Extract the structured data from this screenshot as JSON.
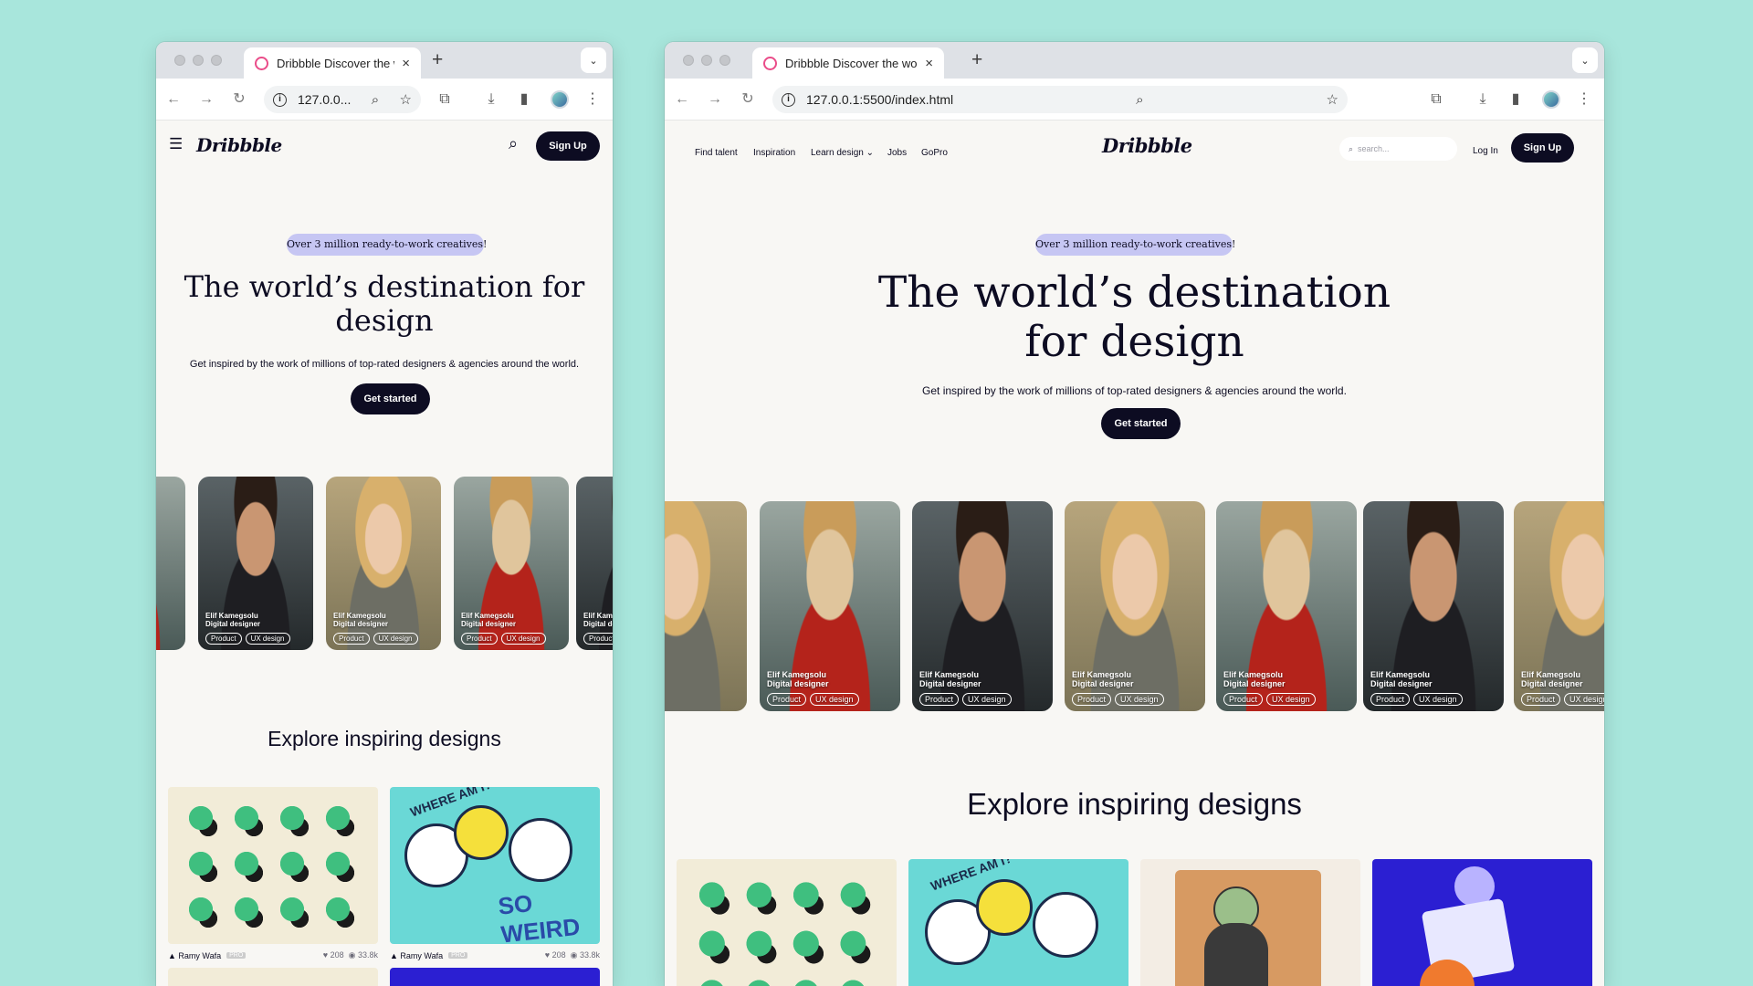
{
  "browser": {
    "tab_title": "Dribbble Discover the world",
    "tab_close": "×",
    "new_tab": "+",
    "tab_menu": "⌄",
    "url_small": "127.0.0...",
    "url_large": "127.0.0.1:5500/index.html",
    "icons": {
      "back": "←",
      "forward": "→",
      "reload": "↻",
      "zoom": "⌕",
      "star": "☆",
      "ext": "⧉",
      "download": "⤓",
      "sidepanel": "▮",
      "menu": "⋮",
      "info": "i"
    }
  },
  "site": {
    "logo": "Dribbble",
    "nav": [
      "Find talent",
      "Inspiration",
      "Learn design ⌄",
      "Jobs",
      "GoPro"
    ],
    "search_placeholder": "search...",
    "login": "Log In",
    "signup": "Sign Up",
    "hamburger": "☰",
    "search_icon": "⌕",
    "badge": "Over 3 million ready-to-work creatives!",
    "hero_title": "The world’s destination for design",
    "hero_title_small_l1": "The world’s destination for",
    "hero_title_small_l2": "design",
    "hero_title_large_l1": "The world’s destination",
    "hero_title_large_l2": "for design",
    "hero_sub": "Get inspired by the work of millions of top-rated designers & agencies around the world.",
    "cta": "Get started",
    "designer": {
      "name": "Elif Kamegsolu",
      "role": "Digital designer",
      "tags": [
        "Product",
        "UX design"
      ]
    },
    "explore_title": "Explore inspiring designs",
    "shots": [
      {
        "author": "Ramy Wafa",
        "badge": "PRO",
        "likes": "♥ 208",
        "views": "◉ 33.8k"
      },
      {
        "author": "Ramy Wafa",
        "badge": "PRO",
        "likes": "♥ 208",
        "views": "◉ 33.8k"
      }
    ],
    "weird_text": "SO WEIRD",
    "where_text": "WHERE AM I?"
  },
  "colors": {
    "accent": "#ea4c89",
    "ink": "#0d0c22",
    "badge": "#c6c6f3",
    "bg": "#a8e6dc"
  }
}
